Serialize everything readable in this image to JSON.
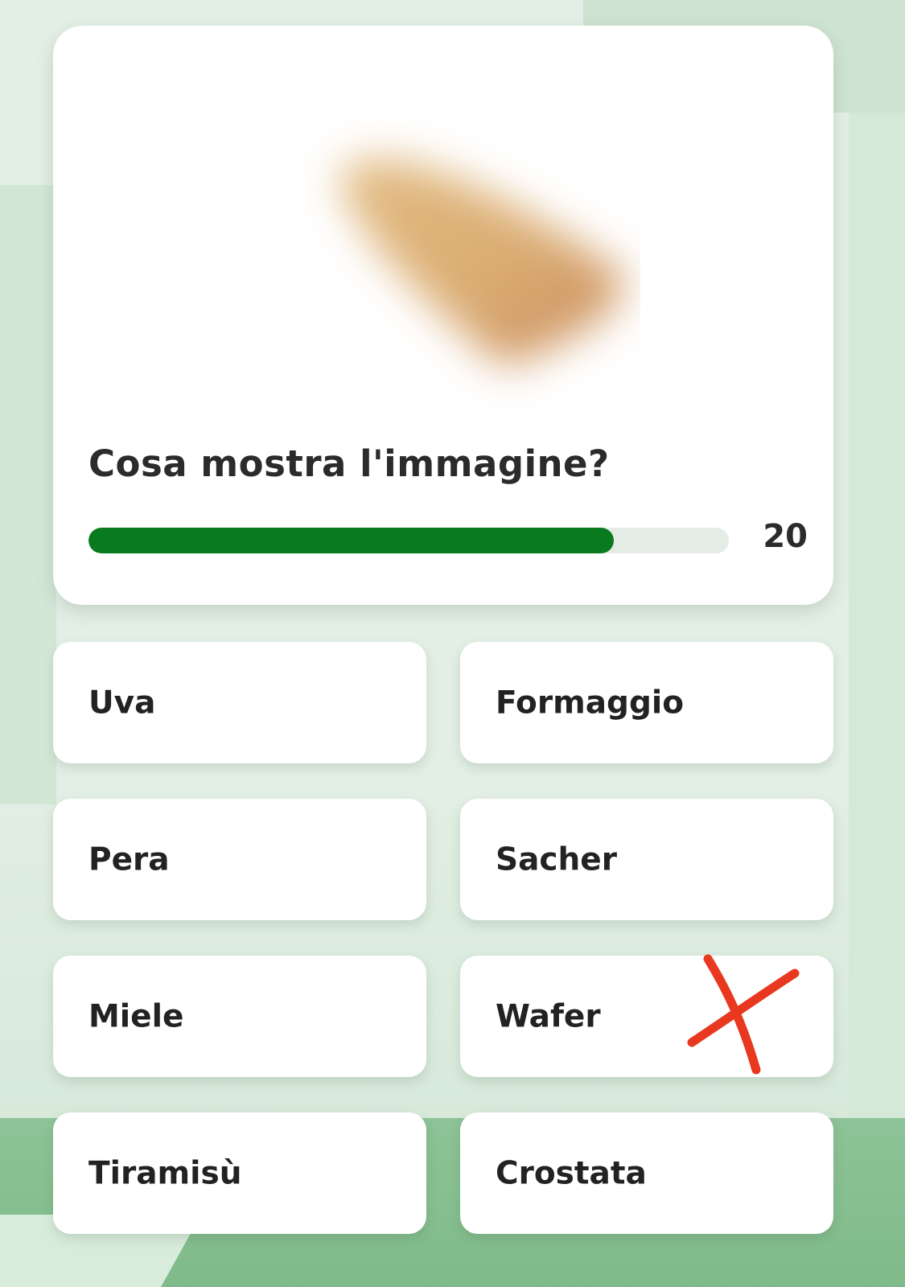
{
  "question": {
    "text": "Cosa mostra l'immagine?",
    "image_icon": "blurred-food-image"
  },
  "timer": {
    "value": "20",
    "progress_fraction": 0.82,
    "bar_color": "#0a7a1e"
  },
  "answers": [
    {
      "label": "Uva"
    },
    {
      "label": "Formaggio"
    },
    {
      "label": "Pera"
    },
    {
      "label": "Sacher"
    },
    {
      "label": "Miele"
    },
    {
      "label": "Wafer",
      "marked_wrong": true,
      "mark_icon": "red-x-mark-icon"
    },
    {
      "label": "Tiramisù"
    },
    {
      "label": "Crostata"
    }
  ],
  "colors": {
    "background": "#e3efe5",
    "card": "#ffffff",
    "wrong_mark": "#e8381f"
  }
}
